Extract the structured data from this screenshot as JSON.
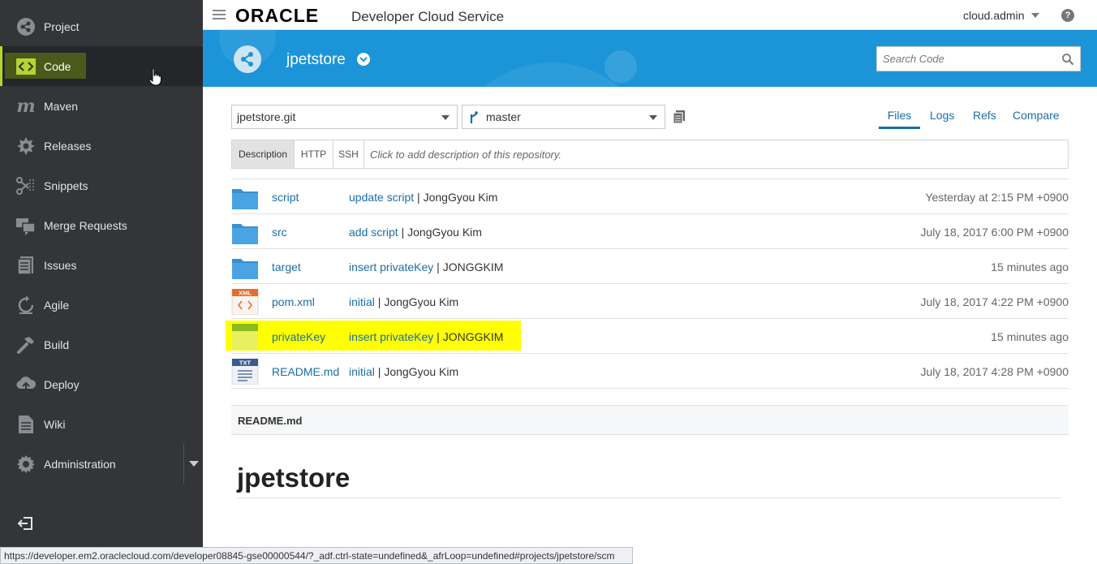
{
  "sidebar": {
    "items": [
      {
        "label": "Project",
        "icon": "project-icon"
      },
      {
        "label": "Code",
        "icon": "code-icon"
      },
      {
        "label": "Maven",
        "icon": "maven-icon"
      },
      {
        "label": "Releases",
        "icon": "releases-icon"
      },
      {
        "label": "Snippets",
        "icon": "snippets-icon"
      },
      {
        "label": "Merge Requests",
        "icon": "merge-requests-icon"
      },
      {
        "label": "Issues",
        "icon": "issues-icon"
      },
      {
        "label": "Agile",
        "icon": "agile-icon"
      },
      {
        "label": "Build",
        "icon": "build-icon"
      },
      {
        "label": "Deploy",
        "icon": "deploy-icon"
      },
      {
        "label": "Wiki",
        "icon": "wiki-icon"
      },
      {
        "label": "Administration",
        "icon": "administration-icon"
      }
    ],
    "active": "Code"
  },
  "topbar": {
    "brand": "ORACLE",
    "product": "Developer Cloud Service",
    "user": "cloud.admin",
    "help": "?"
  },
  "banner": {
    "project_name": "jpetstore",
    "search_placeholder": "Search Code"
  },
  "repo": {
    "repository": "jpetstore.git",
    "branch": "master"
  },
  "tabs": [
    "Files",
    "Logs",
    "Refs",
    "Compare"
  ],
  "active_tab": "Files",
  "description": {
    "tabs": [
      "Description",
      "HTTP",
      "SSH"
    ],
    "text": "Click to add description of this repository."
  },
  "files": [
    {
      "name": "script",
      "type": "folder",
      "commit_msg": "update script",
      "author": "JongGyou Kim",
      "date": "Yesterday at 2:15 PM +0900"
    },
    {
      "name": "src",
      "type": "folder",
      "commit_msg": "add script",
      "author": "JongGyou Kim",
      "date": "July 18, 2017 6:00 PM +0900"
    },
    {
      "name": "target",
      "type": "folder",
      "commit_msg": "insert privateKey",
      "author": "JONGGKIM",
      "date": "15 minutes ago"
    },
    {
      "name": "pom.xml",
      "type": "xml",
      "badge": "XML",
      "commit_msg": "initial",
      "author": "JongGyou Kim",
      "date": "July 18, 2017 4:22 PM +0900"
    },
    {
      "name": "privateKey",
      "type": "file",
      "commit_msg": "insert privateKey",
      "author": "JONGGKIM",
      "date": "15 minutes ago",
      "highlighted": true
    },
    {
      "name": "README.md",
      "type": "txt",
      "badge": "TXT",
      "commit_msg": "initial",
      "author": "JongGyou Kim",
      "date": "July 18, 2017 4:28 PM +0900"
    }
  ],
  "readme": {
    "filename": "README.md",
    "heading": "jpetstore"
  },
  "statusbar": {
    "url": "https://developer.em2.oraclecloud.com/developer08845-gse00000544/?_adf.ctrl-state=undefined&_afrLoop=undefined#projects/jpetstore/scm"
  },
  "colors": {
    "sidebar_bg": "#333538",
    "banner_blue": "#1c94d8",
    "link_blue": "#1a6ea8",
    "highlight_yellow": "#ffff00",
    "active_green": "#b7d42c"
  }
}
